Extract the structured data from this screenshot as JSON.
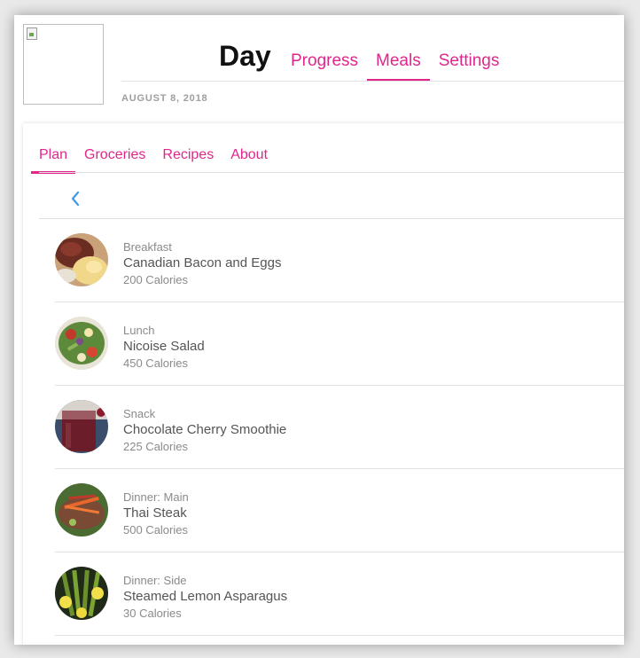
{
  "header": {
    "title": "Day",
    "date": "AUGUST 8, 2018",
    "nav": [
      {
        "label": "Progress",
        "active": false
      },
      {
        "label": "Meals",
        "active": true
      },
      {
        "label": "Settings",
        "active": false
      }
    ]
  },
  "subnav": [
    {
      "label": "Plan",
      "active": true
    },
    {
      "label": "Groceries",
      "active": false
    },
    {
      "label": "Recipes",
      "active": false
    },
    {
      "label": "About",
      "active": false
    }
  ],
  "meals": [
    {
      "type": "Breakfast",
      "name": "Canadian Bacon and Eggs",
      "calories": "200 Calories"
    },
    {
      "type": "Lunch",
      "name": "Nicoise Salad",
      "calories": "450 Calories"
    },
    {
      "type": "Snack",
      "name": "Chocolate Cherry Smoothie",
      "calories": "225 Calories"
    },
    {
      "type": "Dinner: Main",
      "name": "Thai Steak",
      "calories": "500 Calories"
    },
    {
      "type": "Dinner: Side",
      "name": "Steamed Lemon Asparagus",
      "calories": "30 Calories"
    }
  ],
  "colors": {
    "accent": "#e0268c",
    "back_arrow": "#3d9be9"
  },
  "icons": {
    "back": "chevron-left-icon",
    "logo": "broken-image-icon"
  }
}
